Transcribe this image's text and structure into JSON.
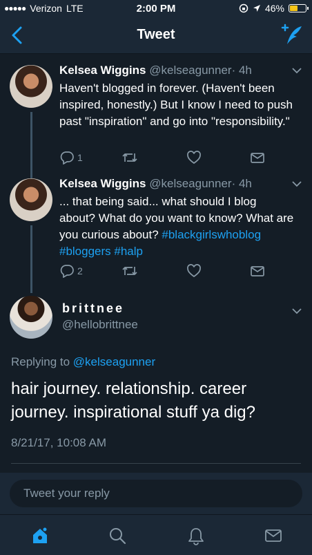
{
  "status_bar": {
    "carrier": "Verizon",
    "network": "LTE",
    "time": "2:00 PM",
    "battery": "46%",
    "battery_level": 0.46
  },
  "nav": {
    "title": "Tweet",
    "back_icon": "chevron-left-icon",
    "compose_icon": "compose-tweet-icon"
  },
  "thread": [
    {
      "name": "Kelsea Wiggins",
      "handle": "@kelseagunner",
      "time": "· 4h",
      "text": "Haven't blogged in forever. (Haven't been inspired, honestly.) But I know I need to push past \"inspiration\" and go into \"responsibility.\"",
      "hashtags": "",
      "reply_count": "1"
    },
    {
      "name": "Kelsea Wiggins",
      "handle": "@kelseagunner",
      "time": "· 4h",
      "text": "... that being said... what should I blog about? What do you want to know? What are you curious about?",
      "hashtags": "#blackgirlswhoblog #bloggers #halp",
      "reply_count": "2"
    }
  ],
  "main_tweet": {
    "name": "brittnee",
    "handle": "@hellobrittnee",
    "replying_to_label": "Replying to",
    "replying_to_handle": "@kelseagunner",
    "text": "hair journey. relationship. career journey. inspirational stuff ya dig?",
    "date": "8/21/17, 10:08 AM"
  },
  "reply_box": {
    "placeholder": "Tweet your reply"
  },
  "tab_bar": {
    "items": [
      "home-icon",
      "search-icon",
      "notifications-icon",
      "messages-icon"
    ]
  },
  "colors": {
    "background": "#141d26",
    "bar": "#1b2836",
    "accent": "#1da1f2",
    "muted": "#8899a6"
  }
}
